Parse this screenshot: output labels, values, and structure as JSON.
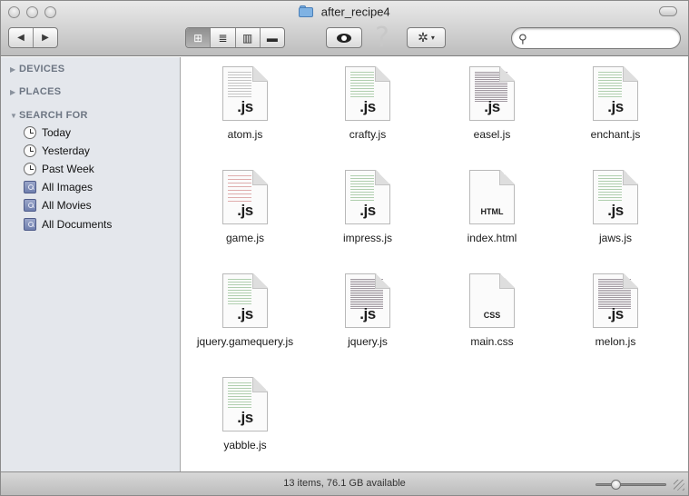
{
  "window": {
    "title": "after_recipe4"
  },
  "toolbar": {
    "back_label": "◀",
    "forward_label": "▶",
    "views": [
      {
        "name": "icon-view",
        "glyph": "⊞"
      },
      {
        "name": "list-view",
        "glyph": "≣"
      },
      {
        "name": "column-view",
        "glyph": "▥"
      },
      {
        "name": "coverflow-view",
        "glyph": "▬"
      }
    ],
    "help_glyph": "?",
    "action_glyph": "✲",
    "action_caret": "▾",
    "search_glyph": "⚲",
    "search_value": ""
  },
  "sidebar": {
    "sections": [
      {
        "label": "DEVICES",
        "expanded": false
      },
      {
        "label": "PLACES",
        "expanded": false
      },
      {
        "label": "SEARCH FOR",
        "expanded": true
      }
    ],
    "items": [
      {
        "label": "Today",
        "icon": "clock-icon"
      },
      {
        "label": "Yesterday",
        "icon": "clock-icon"
      },
      {
        "label": "Past Week",
        "icon": "clock-icon"
      },
      {
        "label": "All Images",
        "icon": "smart-folder-icon"
      },
      {
        "label": "All Movies",
        "icon": "smart-folder-icon"
      },
      {
        "label": "All Documents",
        "icon": "smart-folder-icon"
      }
    ]
  },
  "files": [
    {
      "name": "atom.js",
      "ext": ".js"
    },
    {
      "name": "crafty.js",
      "ext": ".js"
    },
    {
      "name": "easel.js",
      "ext": ".js"
    },
    {
      "name": "enchant.js",
      "ext": ".js"
    },
    {
      "name": "game.js",
      "ext": ".js"
    },
    {
      "name": "impress.js",
      "ext": ".js"
    },
    {
      "name": "index.html",
      "ext": "HTML"
    },
    {
      "name": "jaws.js",
      "ext": ".js"
    },
    {
      "name": "jquery.gamequery.js",
      "ext": ".js"
    },
    {
      "name": "jquery.js",
      "ext": ".js"
    },
    {
      "name": "main.css",
      "ext": "CSS"
    },
    {
      "name": "melon.js",
      "ext": ".js"
    },
    {
      "name": "yabble.js",
      "ext": ".js"
    }
  ],
  "status": {
    "text": "13 items, 76.1 GB available",
    "zoom_level": 0.25
  },
  "colors": {
    "sidebar_bg": "#e4e7ec",
    "section_text": "#6d7683",
    "folder_blue": "#7fb2e3"
  }
}
